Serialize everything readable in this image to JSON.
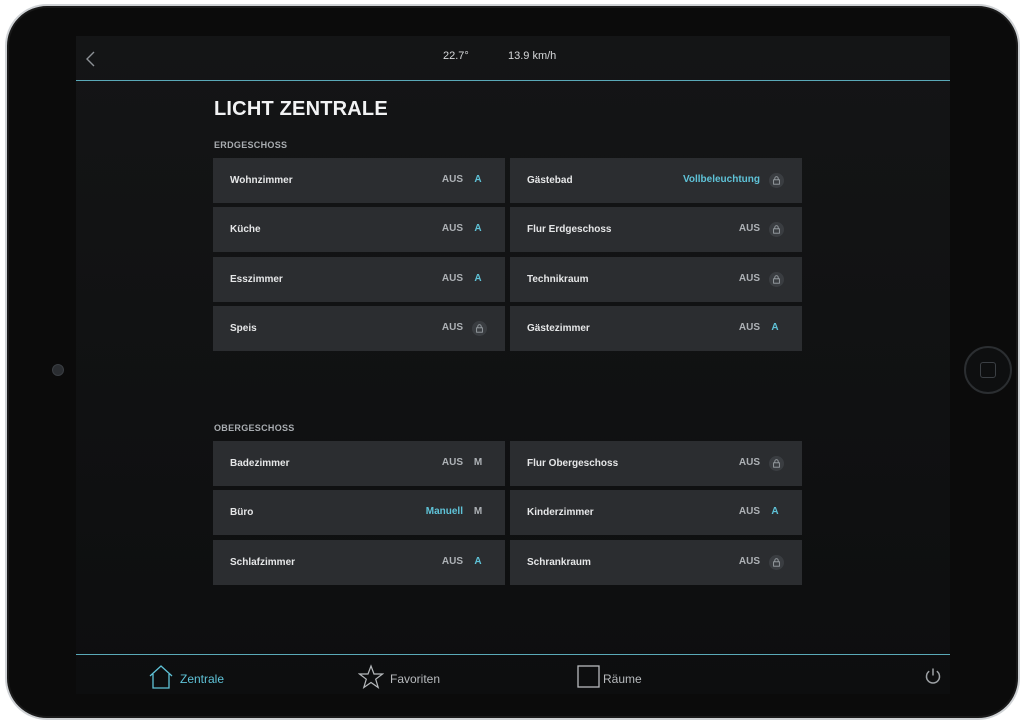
{
  "header": {
    "temperature": "22.7°",
    "wind": "13.9 km/h"
  },
  "page_title": "LICHT ZENTRALE",
  "sections": [
    {
      "title": "ERDGESCHOSS",
      "tiles": [
        {
          "name": "Wohnzimmer",
          "status": "AUS",
          "mode": "A",
          "locked": false
        },
        {
          "name": "Gästebad",
          "status": "Vollbeleuchtung",
          "mode": "",
          "locked": true
        },
        {
          "name": "Küche",
          "status": "AUS",
          "mode": "A",
          "locked": false
        },
        {
          "name": "Flur Erdgeschoss",
          "status": "AUS",
          "mode": "",
          "locked": true
        },
        {
          "name": "Esszimmer",
          "status": "AUS",
          "mode": "A",
          "locked": false
        },
        {
          "name": "Technikraum",
          "status": "AUS",
          "mode": "",
          "locked": true
        },
        {
          "name": "Speis",
          "status": "AUS",
          "mode": "",
          "locked": true
        },
        {
          "name": "Gästezimmer",
          "status": "AUS",
          "mode": "A",
          "locked": false
        }
      ]
    },
    {
      "title": "OBERGESCHOSS",
      "tiles": [
        {
          "name": "Badezimmer",
          "status": "AUS",
          "mode": "M",
          "locked": false
        },
        {
          "name": "Flur Obergeschoss",
          "status": "AUS",
          "mode": "",
          "locked": true
        },
        {
          "name": "Büro",
          "status": "Manuell",
          "mode": "M",
          "locked": false
        },
        {
          "name": "Kinderzimmer",
          "status": "AUS",
          "mode": "A",
          "locked": false
        },
        {
          "name": "Schlafzimmer",
          "status": "AUS",
          "mode": "A",
          "locked": false
        },
        {
          "name": "Schrankraum",
          "status": "AUS",
          "mode": "",
          "locked": true
        }
      ]
    }
  ],
  "bottom_nav": {
    "zentrale": "Zentrale",
    "favoriten": "Favoriten",
    "raeume": "Räume"
  },
  "colors": {
    "accent": "#5fc3d8",
    "tile": "#2b2d30",
    "background": "#141516"
  },
  "icons": {
    "back": "chevron-left-icon",
    "lock": "lock-icon",
    "home": "home-icon",
    "star": "star-icon",
    "rooms": "square-icon",
    "power": "power-icon"
  }
}
